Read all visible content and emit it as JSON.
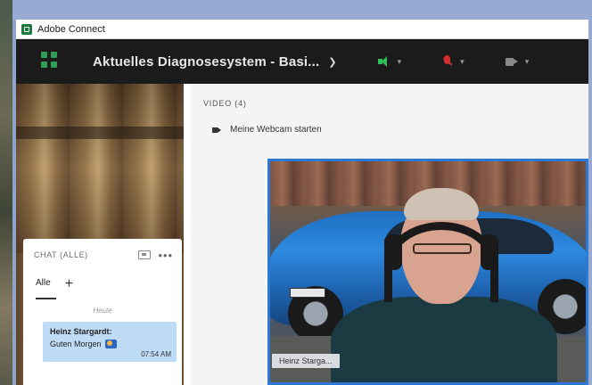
{
  "window": {
    "app_title": "Adobe Connect"
  },
  "topbar": {
    "meeting_title": "Aktuelles Diagnosesystem - Basi...",
    "icons": [
      "apps-menu-icon",
      "speaker-icon",
      "microphone-muted-icon",
      "camera-icon"
    ],
    "colors": {
      "speaker": "#2fbf5a",
      "microphone": "#d32f2f",
      "camera": "#8a8a8a",
      "bar": "#1b1b1b"
    }
  },
  "chat": {
    "title": "CHAT (ALLE)",
    "tabs": [
      {
        "label": "Alle"
      }
    ],
    "date_separator": "Heute",
    "messages": [
      {
        "author": "Heinz Stargardt:",
        "text": "Guten Morgen",
        "time": "07:54 AM"
      }
    ]
  },
  "video": {
    "title": "VIDEO (4)",
    "webcam_button": "Meine Webcam starten",
    "tiles": [
      {
        "name_label": "Heinz Starga..."
      }
    ],
    "colors": {
      "active_border": "#2d78d2"
    }
  }
}
